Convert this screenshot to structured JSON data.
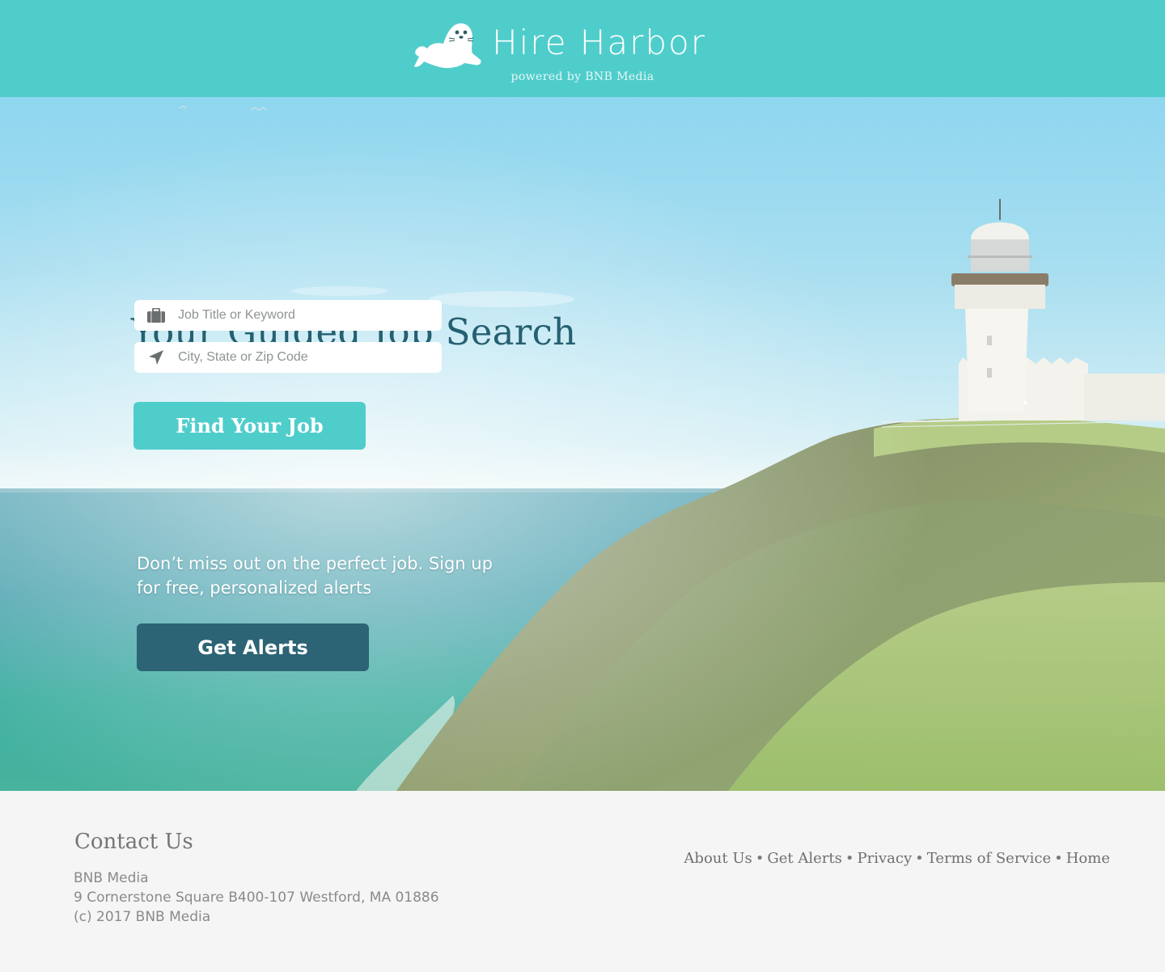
{
  "header": {
    "brand_name": "Hire Harbor",
    "powered_by": "powered by BNB Media"
  },
  "hero": {
    "title": "Your Guided Job Search",
    "job_field": {
      "placeholder": "Job Title or Keyword",
      "value": ""
    },
    "location_field": {
      "placeholder": "City, State or Zip Code",
      "value": ""
    },
    "find_button_label": "Find Your Job",
    "alerts_text": "Don’t miss out on the perfect job. Sign up for free, personalized alerts",
    "alerts_button_label": "Get Alerts"
  },
  "footer": {
    "contact_title": "Contact Us",
    "contact_lines": [
      "BNB Media",
      "9 Cornerstone Square B400-107 Westford, MA 01886",
      "(c) 2017 BNB Media"
    ],
    "nav": [
      {
        "label": "About Us"
      },
      {
        "label": "Get Alerts"
      },
      {
        "label": "Privacy"
      },
      {
        "label": "Terms of Service"
      },
      {
        "label": "Home"
      }
    ],
    "nav_separator": "•"
  },
  "colors": {
    "accent_teal": "#4fcdcb",
    "dark_teal": "#2c6475",
    "title_teal": "#246070"
  },
  "icons": {
    "logo": "seal-icon",
    "job_field": "briefcase-icon",
    "location_field": "location-arrow-icon"
  }
}
